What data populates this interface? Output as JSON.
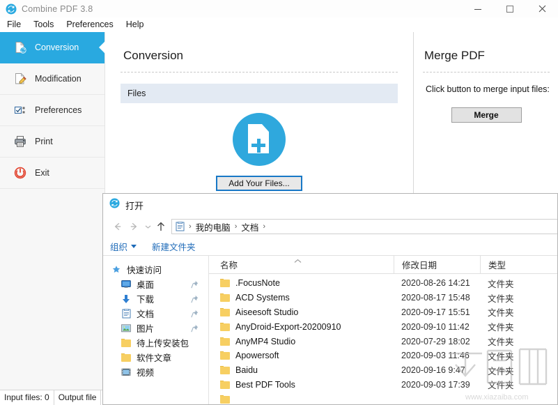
{
  "window": {
    "title": "Combine PDF 3.8",
    "icon": "refresh-circle-icon",
    "controls": {
      "minimize": "–",
      "maximize": "□",
      "close": "✕"
    }
  },
  "menubar": {
    "items": [
      {
        "label": "File"
      },
      {
        "label": "Tools"
      },
      {
        "label": "Preferences"
      },
      {
        "label": "Help"
      }
    ]
  },
  "sidebar": {
    "items": [
      {
        "label": "Conversion",
        "icon": "document-convert-icon",
        "active": true
      },
      {
        "label": "Modification",
        "icon": "document-edit-icon",
        "active": false
      },
      {
        "label": "Preferences",
        "icon": "checkbox-list-icon",
        "active": false
      },
      {
        "label": "Print",
        "icon": "printer-icon",
        "active": false
      },
      {
        "label": "Exit",
        "icon": "power-icon",
        "active": false
      }
    ]
  },
  "conversion": {
    "title": "Conversion",
    "files_header": "Files",
    "drop_icon": "add-file-icon",
    "add_button": "Add Your Files..."
  },
  "merge": {
    "title": "Merge PDF",
    "hint": "Click button to merge input files:",
    "button": "Merge"
  },
  "statusbar": {
    "input_files": "Input files: 0",
    "output_files": "Output file"
  },
  "dialog": {
    "title": "打开",
    "title_icon": "refresh-circle-icon",
    "nav": {
      "back_icon": "arrow-left-icon",
      "forward_icon": "arrow-right-icon",
      "history_icon": "chevron-down-icon",
      "up_icon": "arrow-up-icon",
      "address_icon": "documents-icon",
      "breadcrumbs": [
        "我的电脑",
        "文档"
      ],
      "separator": "›"
    },
    "toolbar": {
      "organize": "组织",
      "organize_caret_icon": "caret-down-icon",
      "new_folder": "新建文件夹"
    },
    "navpane": [
      {
        "label": "快速访问",
        "icon": "star-pin-icon",
        "pinned": false,
        "child": false
      },
      {
        "label": "桌面",
        "icon": "desktop-icon",
        "pinned": true,
        "child": true
      },
      {
        "label": "下载",
        "icon": "download-arrow-icon",
        "pinned": true,
        "child": true
      },
      {
        "label": "文档",
        "icon": "documents-icon",
        "pinned": true,
        "child": true
      },
      {
        "label": "图片",
        "icon": "pictures-icon",
        "pinned": true,
        "child": true
      },
      {
        "label": "待上传安装包",
        "icon": "folder-icon",
        "pinned": false,
        "child": true
      },
      {
        "label": "软件文章",
        "icon": "folder-icon",
        "pinned": false,
        "child": true
      },
      {
        "label": "视频",
        "icon": "video-icon",
        "pinned": false,
        "child": true
      }
    ],
    "columns": [
      "名称",
      "修改日期",
      "类型"
    ],
    "sort_indicator": "sort-ascending-icon",
    "rows": [
      {
        "name": ".FocusNote",
        "date": "2020-08-26 14:21",
        "type": "文件夹"
      },
      {
        "name": "ACD Systems",
        "date": "2020-08-17 15:48",
        "type": "文件夹"
      },
      {
        "name": "Aiseesoft Studio",
        "date": "2020-09-17 15:51",
        "type": "文件夹"
      },
      {
        "name": "AnyDroid-Export-20200910",
        "date": "2020-09-10 11:42",
        "type": "文件夹"
      },
      {
        "name": "AnyMP4 Studio",
        "date": "2020-07-29 18:02",
        "type": "文件夹"
      },
      {
        "name": "Apowersoft",
        "date": "2020-09-03 11:46",
        "type": "文件夹"
      },
      {
        "name": "Baidu",
        "date": "2020-09-16 9:47",
        "type": "文件夹"
      },
      {
        "name": "Best PDF Tools",
        "date": "2020-09-03 17:39",
        "type": "文件夹"
      }
    ]
  },
  "watermark": {
    "text": "下载吧",
    "url": "www.xiazaiba.com"
  },
  "colors": {
    "accent": "#29a9e0",
    "sidebar_bg": "#f7f7f7",
    "files_bar": "#e3eaf3",
    "link_blue": "#1d6ab8",
    "folder_yellow": "#f7cf62"
  }
}
